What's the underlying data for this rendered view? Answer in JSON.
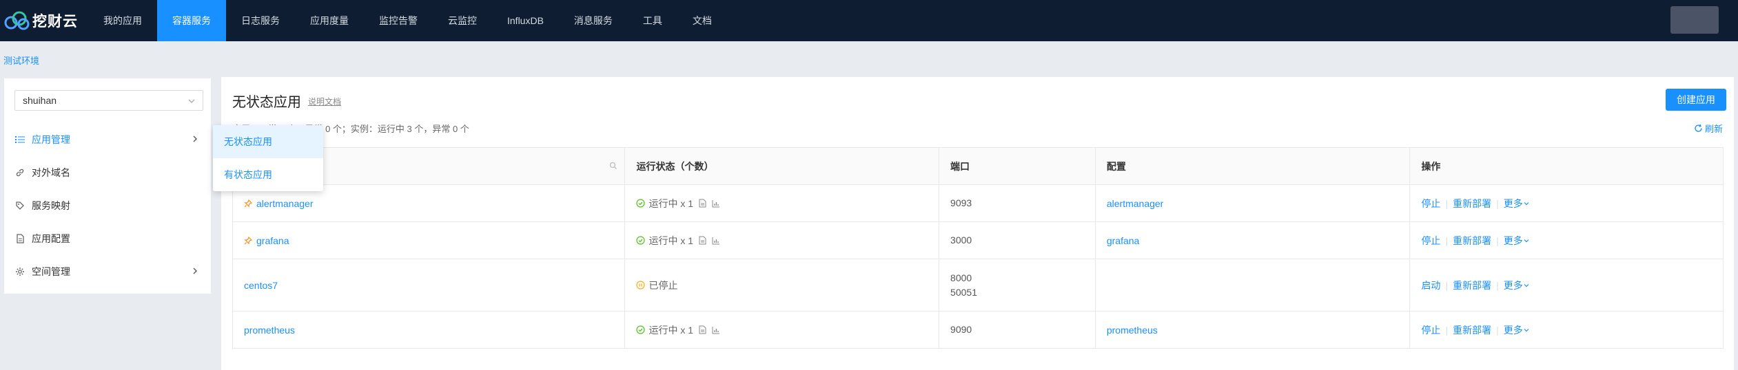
{
  "app": {
    "logo_text": "挖财云"
  },
  "nav": {
    "items": [
      {
        "label": "我的应用"
      },
      {
        "label": "容器服务",
        "active": true
      },
      {
        "label": "日志服务"
      },
      {
        "label": "应用度量"
      },
      {
        "label": "监控告警"
      },
      {
        "label": "云监控"
      },
      {
        "label": "InfluxDB"
      },
      {
        "label": "消息服务"
      },
      {
        "label": "工具"
      },
      {
        "label": "文档"
      }
    ]
  },
  "breadcrumb": {
    "env": "测试环境"
  },
  "sidebar": {
    "space": "shuihan",
    "items": [
      {
        "label": "应用管理",
        "icon": "list-icon"
      },
      {
        "label": "对外域名",
        "icon": "link-icon"
      },
      {
        "label": "服务映射",
        "icon": "tag-icon"
      },
      {
        "label": "应用配置",
        "icon": "file-icon"
      },
      {
        "label": "空间管理",
        "icon": "gear-icon"
      }
    ],
    "submenu": [
      {
        "label": "无状态应用"
      },
      {
        "label": "有状态应用"
      }
    ]
  },
  "main": {
    "title": "无状态应用",
    "doc_link": "说明文档",
    "create_button": "创建应用",
    "summary": "应用：正常 4 个，异常 0 个；实例：运行中 3 个，异常 0 个",
    "refresh": "刷新",
    "columns": [
      "",
      "运行状态（个数）",
      "端口",
      "配置",
      "操作"
    ],
    "rows": [
      {
        "name": "alertmanager",
        "pinned": true,
        "status": "运行中 x 1",
        "ports": [
          "9093"
        ],
        "config": "alertmanager",
        "ops": [
          "停止",
          "重新部署",
          "更多"
        ]
      },
      {
        "name": "grafana",
        "pinned": true,
        "status": "运行中 x 1",
        "ports": [
          "3000"
        ],
        "config": "grafana",
        "ops": [
          "停止",
          "重新部署",
          "更多"
        ]
      },
      {
        "name": "centos7",
        "pinned": false,
        "status": "已停止",
        "ports": [
          "8000",
          "50051"
        ],
        "config": "",
        "ops": [
          "启动",
          "重新部署",
          "更多"
        ]
      },
      {
        "name": "prometheus",
        "pinned": false,
        "status": "运行中 x 1",
        "ports": [
          "9090"
        ],
        "config": "prometheus",
        "ops": [
          "停止",
          "重新部署",
          "更多"
        ]
      }
    ]
  },
  "colors": {
    "primary": "#1890ff",
    "nav_bg": "#0f1d32",
    "running": "#52c41a",
    "stopped": "#faad14",
    "pin": "#fa8c16"
  }
}
